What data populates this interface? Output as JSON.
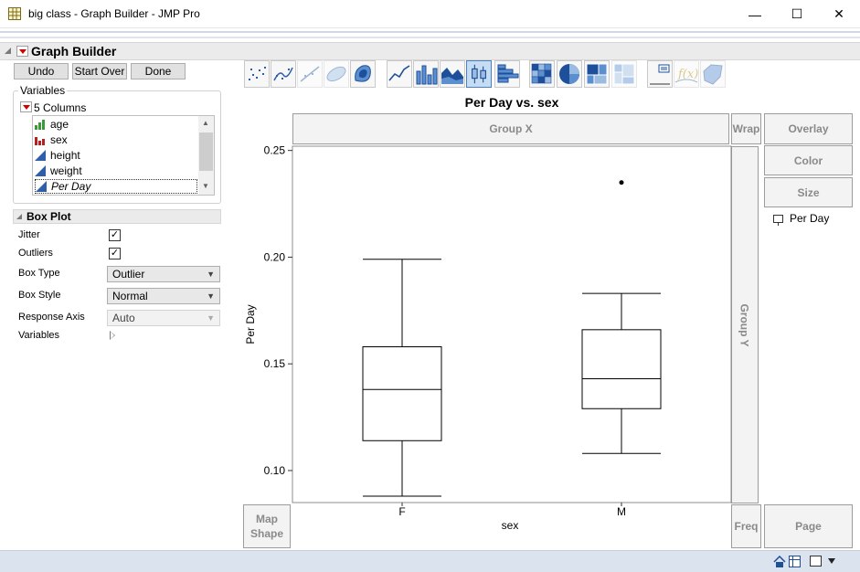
{
  "window": {
    "title": "big class - Graph Builder - JMP Pro",
    "controls": {
      "minimize": "—",
      "maximize": "☐",
      "close": "✕"
    }
  },
  "graph_builder": {
    "title": "Graph Builder",
    "buttons": {
      "undo": "Undo",
      "start_over": "Start Over",
      "done": "Done"
    }
  },
  "variables": {
    "label": "Variables",
    "columns_label": "5 Columns",
    "columns": [
      {
        "name": "age",
        "type": "ordinal",
        "icon": "ordinal-icon"
      },
      {
        "name": "sex",
        "type": "nominal",
        "icon": "nominal-icon"
      },
      {
        "name": "height",
        "type": "continuous",
        "icon": "continuous-icon"
      },
      {
        "name": "weight",
        "type": "continuous",
        "icon": "continuous-icon"
      },
      {
        "name": "Per Day",
        "type": "continuous",
        "icon": "continuous-icon",
        "selected": true
      }
    ]
  },
  "box_plot": {
    "title": "Box Plot",
    "jitter": {
      "label": "Jitter",
      "checked": true
    },
    "outliers": {
      "label": "Outliers",
      "checked": true
    },
    "box_type": {
      "label": "Box Type",
      "value": "Outlier"
    },
    "box_style": {
      "label": "Box Style",
      "value": "Normal"
    },
    "response_axis": {
      "label": "Response Axis",
      "value": "Auto",
      "disabled": true
    },
    "variables": {
      "label": "Variables"
    }
  },
  "toolbar": {
    "active": "box-plot",
    "items": [
      "points",
      "smoother",
      "line-of-fit",
      "ellipse",
      "contour",
      "line",
      "bar",
      "area",
      "box-plot",
      "histogram",
      "heatmap",
      "pie",
      "treemap",
      "mosaic",
      "caption-box",
      "formula",
      "map-shapes"
    ]
  },
  "zones": {
    "group_x": "Group X",
    "group_y": "Group Y",
    "wrap": "Wrap",
    "overlay": "Overlay",
    "color": "Color",
    "size": "Size",
    "map_shape_line1": "Map",
    "map_shape_line2": "Shape",
    "freq": "Freq",
    "page": "Page"
  },
  "legend": {
    "item": "Per Day"
  },
  "chart_data": {
    "type": "box",
    "title": "Per Day vs. sex",
    "xlabel": "sex",
    "ylabel": "Per Day",
    "categories": [
      "F",
      "M"
    ],
    "ylim": [
      0.085,
      0.252
    ],
    "yticks": [
      0.1,
      0.15,
      0.2,
      0.25
    ],
    "ytick_labels": [
      "0.10",
      "0.15",
      "0.20",
      "0.25"
    ],
    "boxes": [
      {
        "category": "F",
        "min": 0.088,
        "q1": 0.114,
        "median": 0.138,
        "q3": 0.158,
        "max": 0.199,
        "outliers": []
      },
      {
        "category": "M",
        "min": 0.108,
        "q1": 0.129,
        "median": 0.143,
        "q3": 0.166,
        "max": 0.183,
        "outliers": [
          0.235
        ]
      }
    ]
  },
  "statusbar": {
    "icons": [
      "home-icon",
      "data-table-icon",
      "window-list-icon",
      "menu-caret-icon"
    ]
  }
}
